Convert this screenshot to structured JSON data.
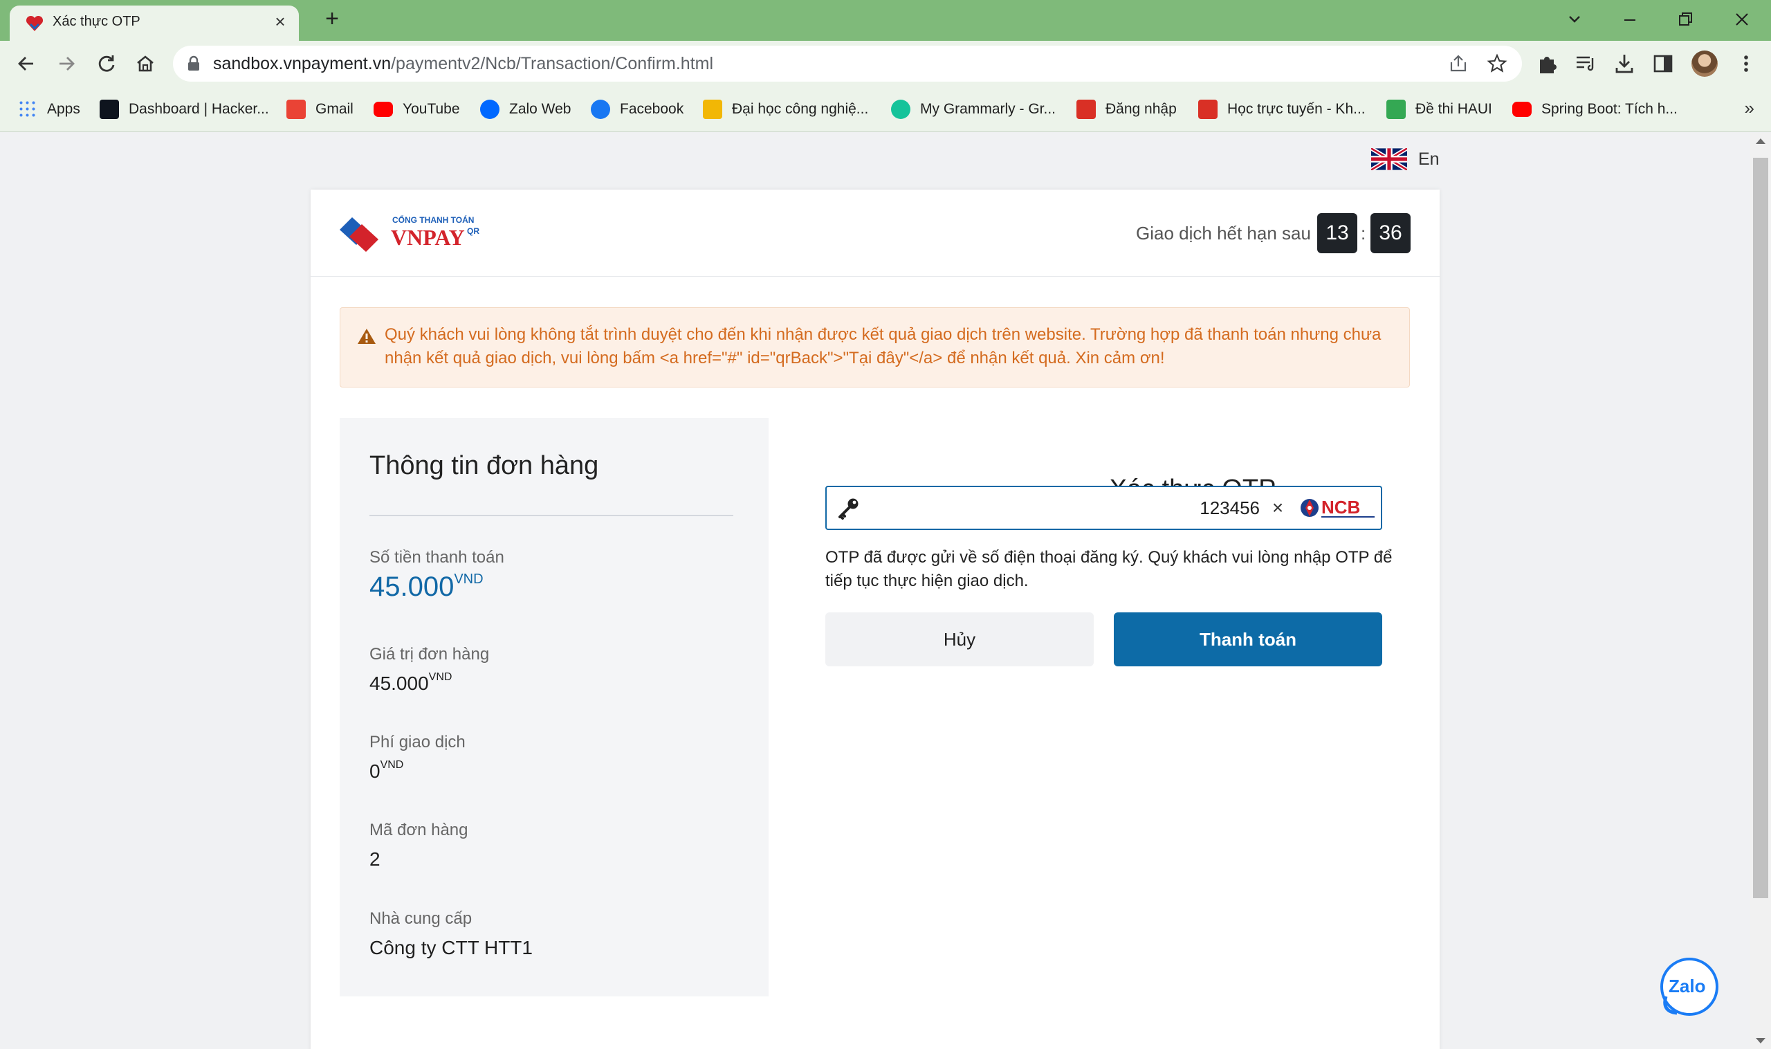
{
  "browser": {
    "tab_title": "Xác thực OTP",
    "url_host": "sandbox.vnpayment.vn",
    "url_path": "/paymentv2/Ncb/Transaction/Confirm.html",
    "bookmarks": [
      {
        "label": "Apps",
        "icon": "apps-grid-icon",
        "color": "#4285f4"
      },
      {
        "label": "Dashboard | Hacker...",
        "icon": "hackerrank-icon",
        "color": "#0e141e"
      },
      {
        "label": "Gmail",
        "icon": "gmail-icon",
        "color": "#ea4335"
      },
      {
        "label": "YouTube",
        "icon": "youtube-icon",
        "color": "#ff0000"
      },
      {
        "label": "Zalo Web",
        "icon": "zalo-icon",
        "color": "#0068ff"
      },
      {
        "label": "Facebook",
        "icon": "facebook-icon",
        "color": "#1877f2"
      },
      {
        "label": "Đại học công nghiệ...",
        "icon": "haui-icon",
        "color": "#f2b705"
      },
      {
        "label": "My Grammarly - Gr...",
        "icon": "grammarly-icon",
        "color": "#15c39a"
      },
      {
        "label": "Đăng nhập",
        "icon": "code-icon",
        "color": "#d93025"
      },
      {
        "label": "Học trực tuyến - Kh...",
        "icon": "code-icon",
        "color": "#d93025"
      },
      {
        "label": "Đề thi HAUI",
        "icon": "puzzle-icon",
        "color": "#34a853"
      },
      {
        "label": "Spring Boot: Tích h...",
        "icon": "youtube-icon",
        "color": "#ff0000"
      }
    ]
  },
  "page": {
    "language": "En",
    "expire_label": "Giao dịch hết hạn sau",
    "timer_minutes": "13",
    "timer_separator": ":",
    "timer_seconds": "36",
    "alert_text": "Quý khách vui lòng không tắt trình duyệt cho đến khi nhận được kết quả giao dịch trên website. Trường hợp đã thanh toán nhưng chưa nhận kết quả giao dịch, vui lòng bấm <a href=\"#\" id=\"qrBack\">\"Tại đây\"</a> để nhận kết quả. Xin cảm ơn!",
    "order": {
      "title": "Thông tin đơn hàng",
      "amount_label": "Số tiền thanh toán",
      "amount_value": "45.000",
      "amount_unit": "VND",
      "order_value_label": "Giá trị đơn hàng",
      "order_value": "45.000",
      "order_value_unit": "VND",
      "fee_label": "Phí giao dịch",
      "fee_value": "0",
      "fee_unit": "VND",
      "order_id_label": "Mã đơn hàng",
      "order_id": "2",
      "provider_label": "Nhà cung cấp",
      "provider": "Công ty CTT HTT1"
    },
    "otp": {
      "title": "Xác thực OTP",
      "value": "123456",
      "clear_symbol": "×",
      "help_text": "OTP đã được gửi về số điện thoại đăng ký. Quý khách vui lòng nhập OTP để tiếp tục thực hiện giao dịch.",
      "cancel_label": "Hủy",
      "pay_label": "Thanh toán"
    },
    "colors": {
      "accent": "#0d6ba7",
      "alert_text": "#d46b1f",
      "alert_bg": "#fdf0e6"
    }
  }
}
